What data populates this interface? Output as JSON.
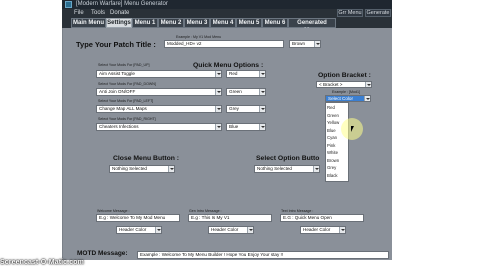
{
  "window": {
    "title": "[Modern Warfare] Menu Generator",
    "menubar": [
      "File",
      "Tools",
      "Donate"
    ],
    "right_buttons": [
      "Grr Menu",
      "Generate"
    ]
  },
  "tabs": [
    "Main Menu",
    "Settings",
    "Menu 1",
    "Menu 2",
    "Menu 3",
    "Menu 4",
    "Menu 5",
    "Menu 6",
    "Generated Menu"
  ],
  "active_tab": "Settings",
  "patch": {
    "heading": "Type Your Patch Title :",
    "example": "Example : My V1 Mod Menu",
    "value": "Modded_HD» v2",
    "color": "Brown"
  },
  "quick_options": {
    "heading": "Quick Menu Options :",
    "rows": [
      {
        "label": "Select Your Mods For [PAD_UP]",
        "value": "Aim Assist Toggle",
        "color": "Red"
      },
      {
        "label": "Select Your Mods For [PAD_DOWN]",
        "value": "Anti Join ON/OFF",
        "color": "Green"
      },
      {
        "label": "Select Your Mods For [PAD_LEFT]",
        "value": "Change Map ALL Maps",
        "color": "Grey"
      },
      {
        "label": "Select Your Mods For [PAD_RIGHT]",
        "value": "Cheaters Infections",
        "color": "Blue"
      }
    ]
  },
  "option_bracket": {
    "heading": "Option Bracket :",
    "value": "< Bracket >",
    "example": "Example : [Mod1]",
    "selected_color": "Select Color",
    "color_options": [
      "Red",
      "Green",
      "Yellow",
      "Blue",
      "Cyan",
      "Pink",
      "White",
      "Brown",
      "Grey",
      "Black"
    ]
  },
  "close_menu": {
    "heading": "Close Menu Button :",
    "value": "Nothing Selected"
  },
  "select_option": {
    "heading": "Select Option Butto",
    "value": "Nothing Selected"
  },
  "messages": [
    {
      "label": "Welcome Message :",
      "value": "E.g : Welcome To My Mod Menu",
      "color_label": "Header Color"
    },
    {
      "label": "Gen Intro Message :",
      "value": "E.g : This Is My V1",
      "color_label": "Header Color"
    },
    {
      "label": "Text Intro Message :",
      "value": "E.G : Quick Menu Open",
      "color_label": "Header Color"
    }
  ],
  "motd": {
    "label": "MOTD Message:",
    "value": "Example : Welcome To My Menu Builder ! Hope You Enjoy Your stay !!"
  },
  "watermark": "Screencast-O-Matic.com"
}
